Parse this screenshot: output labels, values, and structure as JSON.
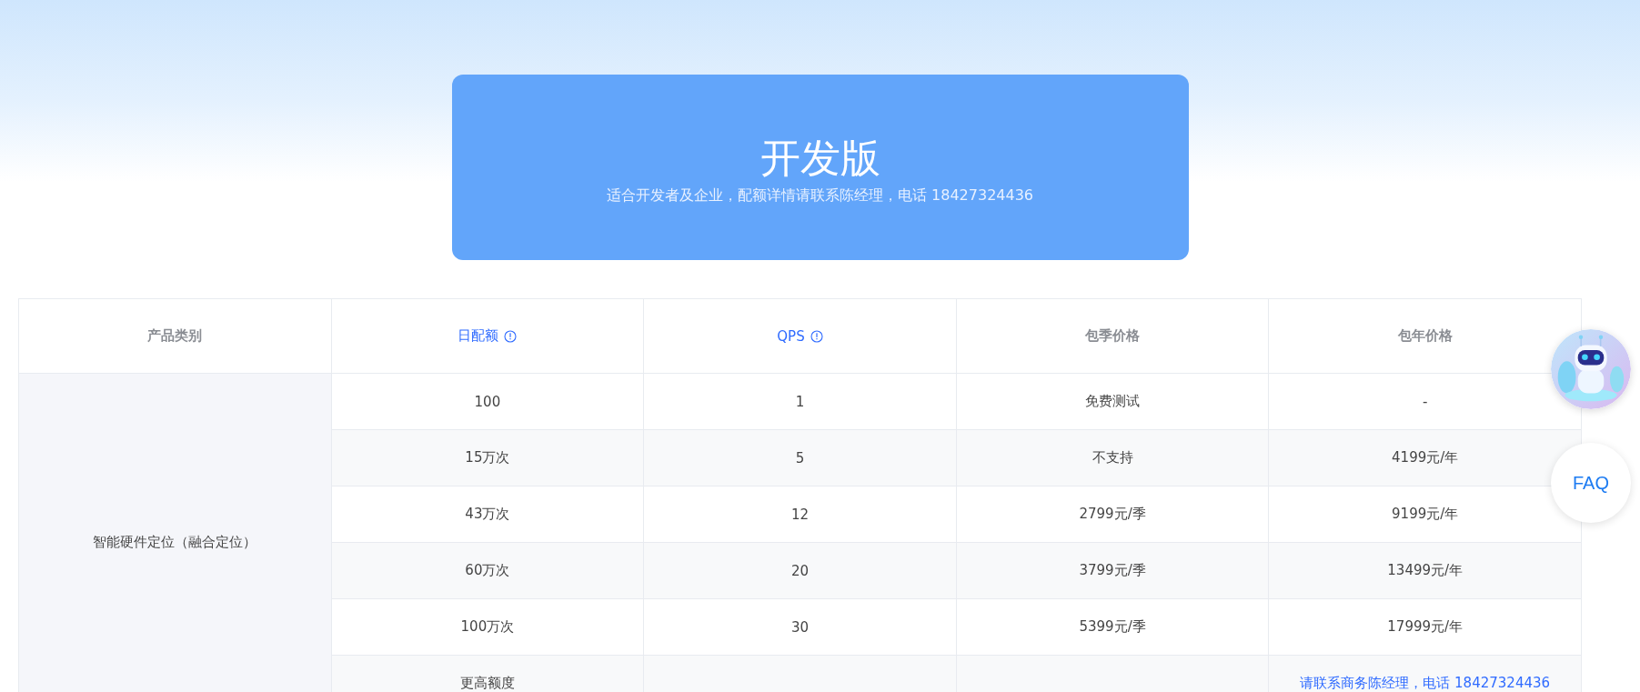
{
  "plan_card": {
    "title": "开发版",
    "subtitle": "适合开发者及企业，配额详情请联系陈经理，电话 18427324436"
  },
  "table": {
    "columns": [
      {
        "label": "产品类别",
        "kind": "plain"
      },
      {
        "label": "日配额",
        "kind": "info"
      },
      {
        "label": "QPS",
        "kind": "info"
      },
      {
        "label": "包季价格",
        "kind": "plain"
      },
      {
        "label": "包年价格",
        "kind": "plain"
      }
    ],
    "category": "智能硬件定位（融合定位）",
    "rows": [
      {
        "quota": "100",
        "qps": "1",
        "quarter_price": "免费测试",
        "year_price": {
          "text": "-",
          "kind": "plain"
        }
      },
      {
        "quota": "15万次",
        "qps": "5",
        "quarter_price": "不支持",
        "year_price": {
          "text": "4199元/年",
          "kind": "plain"
        }
      },
      {
        "quota": "43万次",
        "qps": "12",
        "quarter_price": "2799元/季",
        "year_price": {
          "text": "9199元/年",
          "kind": "plain"
        }
      },
      {
        "quota": "60万次",
        "qps": "20",
        "quarter_price": "3799元/季",
        "year_price": {
          "text": "13499元/年",
          "kind": "plain"
        }
      },
      {
        "quota": "100万次",
        "qps": "30",
        "quarter_price": "5399元/季",
        "year_price": {
          "text": "17999元/年",
          "kind": "plain"
        }
      },
      {
        "quota": "更高额度",
        "year_price": {
          "text": "请联系商务陈经理，电话 18427324436",
          "kind": "link"
        }
      }
    ]
  },
  "float_buttons": [
    {
      "kind": "assistant"
    },
    {
      "kind": "text",
      "label": "FAQ"
    }
  ]
}
